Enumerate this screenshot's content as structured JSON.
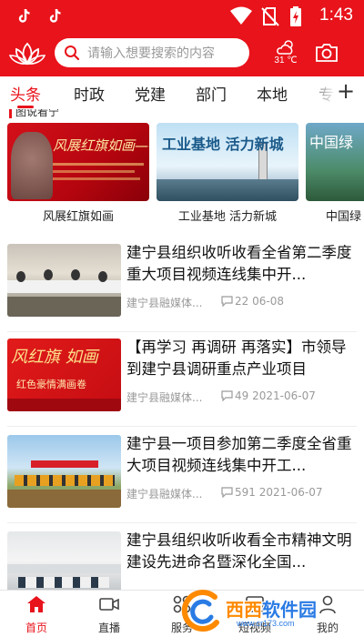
{
  "status_bar": {
    "time": "1:43"
  },
  "header": {
    "search_placeholder": "请输入想要搜索的内容",
    "weather_temp": "31 ℃"
  },
  "tabs": [
    {
      "label": "头条"
    },
    {
      "label": "时政"
    },
    {
      "label": "党建"
    },
    {
      "label": "部门"
    },
    {
      "label": "本地"
    },
    {
      "label": "专"
    }
  ],
  "gallery": {
    "heading": "图说看宁",
    "items": [
      {
        "caption": "风展红旗如画",
        "img_text": "风展红旗如画——三明"
      },
      {
        "caption": "工业基地 活力新城",
        "img_text": "工业基地 活力新城"
      },
      {
        "caption": "中国绿",
        "img_text": "中国绿"
      }
    ]
  },
  "news": [
    {
      "title": "建宁县组织收听收看全省第二季度重大项目视频连线集中开...",
      "source": "建宁县融媒体...",
      "comments": "22",
      "date": "06-08"
    },
    {
      "title": "【再学习 再调研 再落实】市领导到建宁县调研重点产业项目",
      "source": "建宁县融媒体...",
      "comments": "49",
      "date": "2021-06-07"
    },
    {
      "title": "建宁县一项目参加第二季度全省重大项目视频连线集中开工...",
      "source": "建宁县融媒体...",
      "comments": "591",
      "date": "2021-06-07"
    },
    {
      "title": "建宁县组织收听收看全市精神文明建设先进命名暨深化全国...",
      "source": "",
      "comments": "",
      "date": ""
    }
  ],
  "bottom_nav": [
    {
      "label": "首页"
    },
    {
      "label": "直播"
    },
    {
      "label": "服务"
    },
    {
      "label": "短视频"
    },
    {
      "label": "我的"
    }
  ],
  "watermark": {
    "text_orange": "西西",
    "text_blue": "软件园",
    "url": "www.cr173.com"
  },
  "colors": {
    "brand_red": "#e8131b"
  }
}
